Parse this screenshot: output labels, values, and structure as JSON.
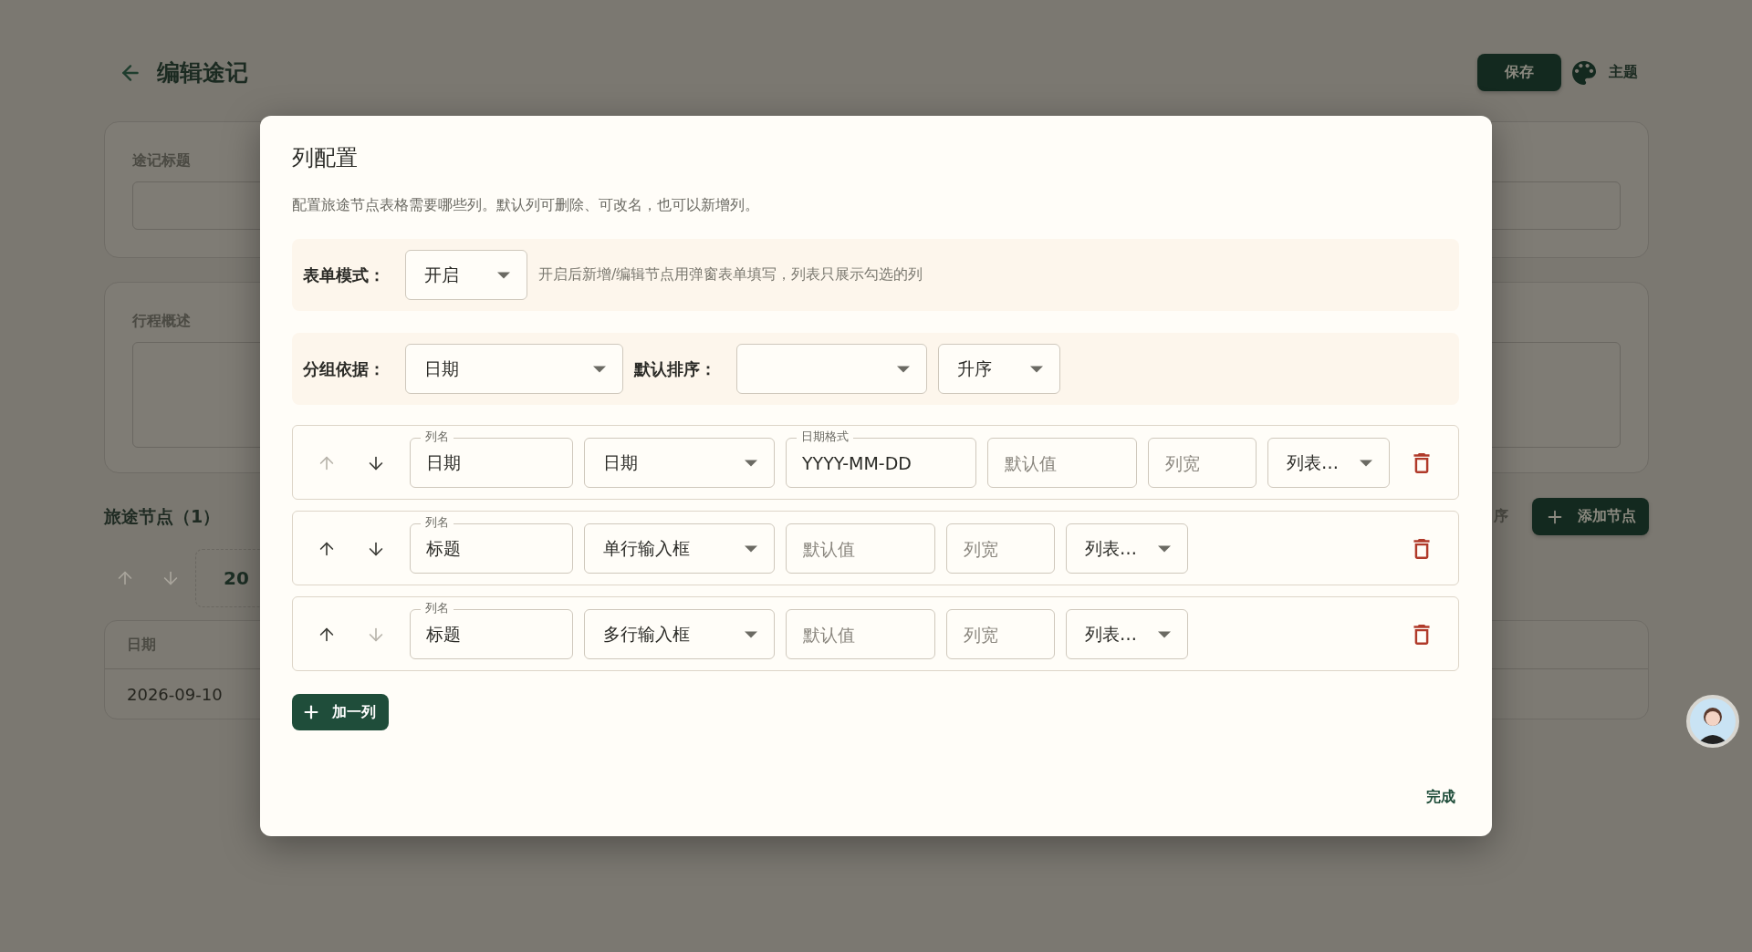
{
  "page": {
    "title": "编辑途记",
    "save_button": "保存",
    "theme_button": "主题",
    "fields": [
      {
        "label": "途记标题",
        "kind": "input"
      },
      {
        "label": "行程概述",
        "kind": "textarea"
      }
    ],
    "nodes": {
      "title": "旅途节点（1）",
      "sort_label": "序",
      "add_button": "添加节点",
      "group_label": "20",
      "table": {
        "columns": [
          "日期"
        ],
        "rows": [
          [
            "2026-09-10"
          ]
        ]
      }
    }
  },
  "dialog": {
    "title": "列配置",
    "description": "配置旅途节点表格需要哪些列。默认列可删除、可改名，也可以新增列。",
    "form_mode": {
      "label": "表单模式：",
      "value": "开启",
      "hint": "开启后新增/编辑节点用弹窗表单填写，列表只展示勾选的列"
    },
    "grouping": {
      "label": "分组依据：",
      "value": "日期",
      "sort_label": "默认排序：",
      "order": "升序"
    },
    "columns": [
      {
        "name_label": "列名",
        "name": "日期",
        "type": "日期",
        "format_label": "日期格式",
        "format": "YYYY-MM-DD",
        "default_placeholder": "默认值",
        "width_placeholder": "列宽",
        "display": "列表…",
        "up_disabled": true,
        "down_disabled": false
      },
      {
        "name_label": "列名",
        "name": "标题",
        "type": "单行输入框",
        "default_placeholder": "默认值",
        "width_placeholder": "列宽",
        "display": "列表…",
        "up_disabled": false,
        "down_disabled": false
      },
      {
        "name_label": "列名",
        "name": "标题",
        "type": "多行输入框",
        "default_placeholder": "默认值",
        "width_placeholder": "列宽",
        "display": "列表…",
        "up_disabled": false,
        "down_disabled": true
      }
    ],
    "add_button": "加一列",
    "done_button": "完成"
  }
}
